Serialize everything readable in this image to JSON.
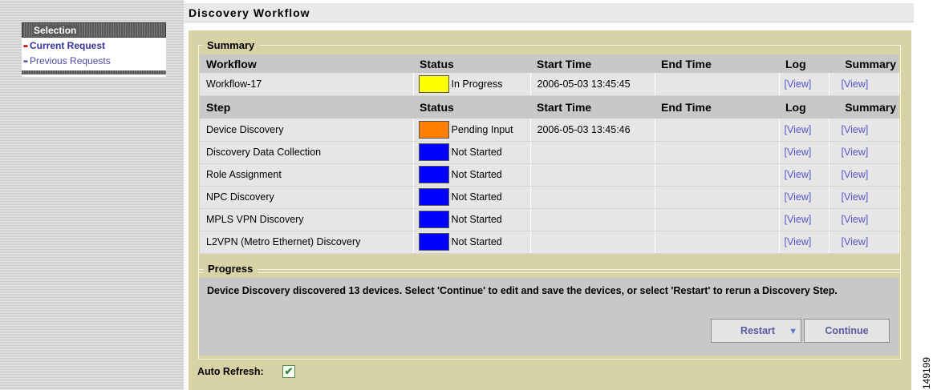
{
  "sidebar": {
    "title": "Selection",
    "items": [
      {
        "label": "Current Request",
        "bullet": "••"
      },
      {
        "label": "Previous Requests",
        "bullet": "••"
      }
    ]
  },
  "page": {
    "title": "Discovery Workflow"
  },
  "summary": {
    "legend": "Summary",
    "workflow_headers": {
      "name": "Workflow",
      "status": "Status",
      "start": "Start Time",
      "end": "End Time",
      "log": "Log",
      "summary": "Summary"
    },
    "workflow": {
      "name": "Workflow-17",
      "status": "In Progress",
      "status_color": "#ffff00",
      "start": "2006-05-03 13:45:45",
      "end": "",
      "log": "[View]",
      "summary": "[View]"
    },
    "step_headers": {
      "name": "Step",
      "status": "Status",
      "start": "Start Time",
      "end": "End Time",
      "log": "Log",
      "summary": "Summary"
    },
    "steps": [
      {
        "name": "Device Discovery",
        "status": "Pending Input",
        "status_color": "#ff7f00",
        "start": "2006-05-03 13:45:46",
        "end": "",
        "log": "[View]",
        "summary": "[View]"
      },
      {
        "name": "Discovery Data Collection",
        "status": "Not Started",
        "status_color": "#0000ff",
        "start": "",
        "end": "",
        "log": "[View]",
        "summary": "[View]"
      },
      {
        "name": "Role Assignment",
        "status": "Not Started",
        "status_color": "#0000ff",
        "start": "",
        "end": "",
        "log": "[View]",
        "summary": "[View]"
      },
      {
        "name": "NPC Discovery",
        "status": "Not Started",
        "status_color": "#0000ff",
        "start": "",
        "end": "",
        "log": "[View]",
        "summary": "[View]"
      },
      {
        "name": "MPLS VPN Discovery",
        "status": "Not Started",
        "status_color": "#0000ff",
        "start": "",
        "end": "",
        "log": "[View]",
        "summary": "[View]"
      },
      {
        "name": "L2VPN (Metro Ethernet) Discovery",
        "status": "Not Started",
        "status_color": "#0000ff",
        "start": "",
        "end": "",
        "log": "[View]",
        "summary": "[View]"
      }
    ]
  },
  "progress": {
    "legend": "Progress",
    "message": "Device Discovery discovered 13 devices. Select 'Continue' to edit and save the devices, or select 'Restart' to rerun a Discovery Step.",
    "restart_label": "Restart",
    "restart_arrow": "▼",
    "continue_label": "Continue"
  },
  "auto_refresh": {
    "label": "Auto Refresh:",
    "checked": true,
    "check_glyph": "✔"
  },
  "figure_number": "149199",
  "colors": {
    "panel": "#d7d3a6",
    "header_row": "#c8c8c8",
    "link": "#5555cc"
  }
}
